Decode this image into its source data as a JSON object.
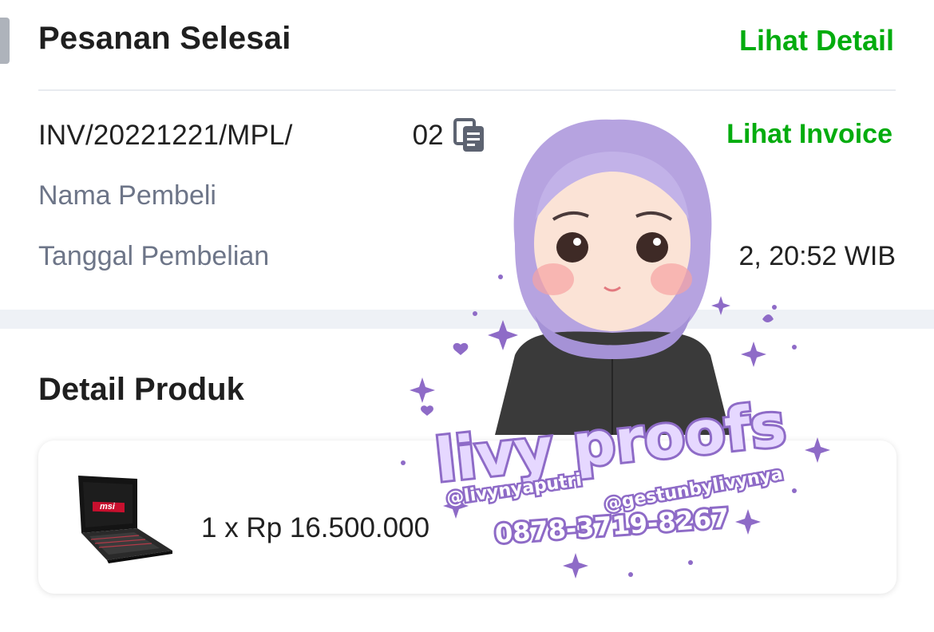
{
  "order": {
    "status_title": "Pesanan Selesai",
    "detail_link": "Lihat Detail",
    "invoice_prefix": "INV/20221221/MPL/",
    "invoice_suffix": "02",
    "invoice_link": "Lihat Invoice",
    "buyer_label": "Nama Pembeli",
    "date_label": "Tanggal Pembelian",
    "date_value_visible": "2, 20:52 WIB"
  },
  "product_section": {
    "title": "Detail Produk",
    "items": [
      {
        "brand_text": "msi",
        "quantity_price": "1 x Rp 16.500.000"
      }
    ]
  },
  "watermark": {
    "brand": "livy proofs",
    "twitter": "@livynyaputri",
    "instagram": "@gestunbylivynya",
    "phone": "0878-3719-8267"
  },
  "colors": {
    "link_green": "#03ac0e",
    "label_gray": "#6d7588",
    "watermark_purple": "#8e6bc7",
    "hijab_lavender": "#b6a3e0"
  }
}
